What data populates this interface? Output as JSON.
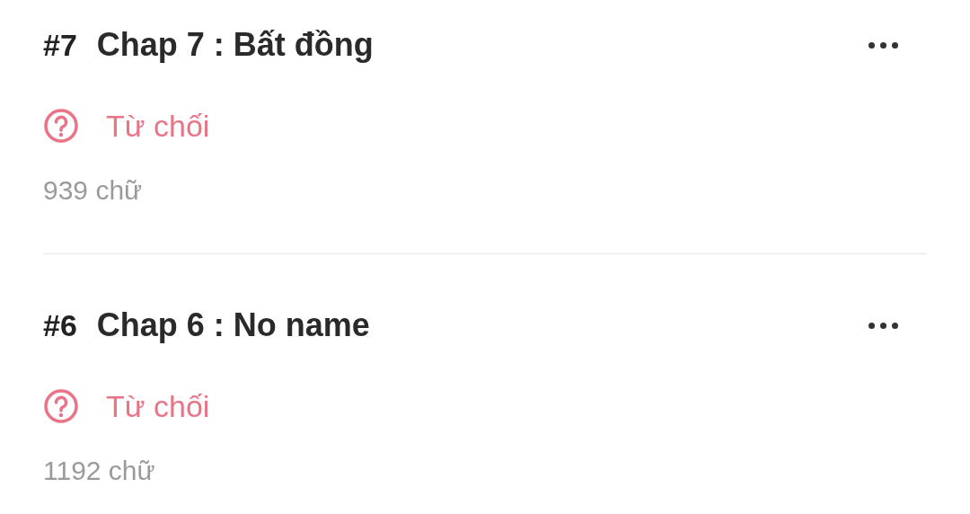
{
  "chapters": [
    {
      "number": "#7",
      "title": "Chap 7 : Bất đồng",
      "status": "Từ chối",
      "words": "939 chữ"
    },
    {
      "number": "#6",
      "title": "Chap 6 : No name",
      "status": "Từ chối",
      "words": "1192 chữ"
    }
  ]
}
